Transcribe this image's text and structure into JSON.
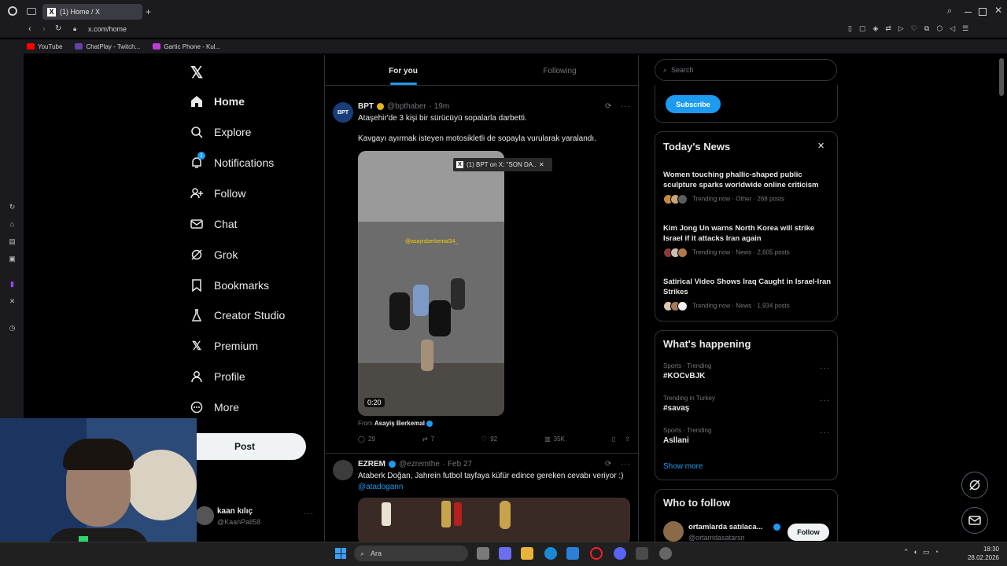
{
  "browser": {
    "tab_title": "(1) Home / X",
    "url": "x.com/home",
    "bookmarks": [
      {
        "label": "YouTube",
        "color": "#ff0000"
      },
      {
        "label": "ChatPlay - Twitch...",
        "color": "#6441a5"
      },
      {
        "label": "Gartic Phone - Kul...",
        "color": "#c03bd8"
      }
    ]
  },
  "nav": {
    "items": [
      {
        "label": "Home",
        "icon": "home-icon"
      },
      {
        "label": "Explore",
        "icon": "search-icon"
      },
      {
        "label": "Notifications",
        "icon": "bell-icon",
        "badge": "1"
      },
      {
        "label": "Follow",
        "icon": "person-plus-icon"
      },
      {
        "label": "Chat",
        "icon": "envelope-icon"
      },
      {
        "label": "Grok",
        "icon": "grok-icon"
      },
      {
        "label": "Bookmarks",
        "icon": "bookmark-icon"
      },
      {
        "label": "Creator Studio",
        "icon": "flask-icon"
      },
      {
        "label": "Premium",
        "icon": "x-logo-icon"
      },
      {
        "label": "Profile",
        "icon": "person-icon"
      },
      {
        "label": "More",
        "icon": "more-circle-icon"
      }
    ],
    "post_label": "Post",
    "account": {
      "name": "kaan kılıç",
      "handle": "@KaanPall58"
    }
  },
  "feed": {
    "tabs": [
      {
        "label": "For you"
      },
      {
        "label": "Following"
      }
    ],
    "tweets": [
      {
        "name": "BPT",
        "handle": "@bpthaber",
        "time": "· 19m",
        "text1": "Ataşehir'de 3 kişi bir sürücüyü sopalarla darbetti.",
        "text2": "Kavgayı ayırmak isteyen motosikletli de sopayla vurularak yaralandı.",
        "video_watermark": "@asayisberkemal34_",
        "video_duration": "0:20",
        "tooltip": "(1) BPT on X: \"SON DA...",
        "from_label": "From",
        "from_name": "Asayiş Berkemal",
        "replies": "29",
        "reposts": "7",
        "likes": "92",
        "views": "35K",
        "avatar_text": "BPT"
      },
      {
        "name": "EZREM",
        "handle": "@ezremthe",
        "time": "· Feb 27",
        "text1": "Ataberk Doğan, Jahrein futbol tayfaya küfür edince gereken cevabı veriyor :)",
        "mention": "@atadogann"
      }
    ]
  },
  "right": {
    "search_placeholder": "Search",
    "subscribe_label": "Subscribe",
    "todays_news": {
      "title": "Today's News",
      "items": [
        {
          "headline": "Women touching phallic-shaped public sculpture sparks worldwide online criticism",
          "meta": "Trending now · Other · 268 posts"
        },
        {
          "headline": "Kim Jong Un warns North Korea will strike Israel if it attacks Iran again",
          "meta": "Trending now · News · 2,605 posts"
        },
        {
          "headline": "Satirical Video Shows Iraq Caught in Israel-Iran Strikes",
          "meta": "Trending now · News · 1,934 posts"
        }
      ]
    },
    "whats_happening": {
      "title": "What's happening",
      "items": [
        {
          "category": "Sports · Trending",
          "name": "#KOCvBJK"
        },
        {
          "category": "Trending in Turkey",
          "name": "#savaş"
        },
        {
          "category": "Sports · Trending",
          "name": "Asllani"
        }
      ],
      "show_more": "Show more"
    },
    "who_to_follow": {
      "title": "Who to follow",
      "user_name": "ortamlarda satılaca...",
      "user_handle": "@ortamdasatarsn",
      "follow_label": "Follow"
    }
  },
  "taskbar": {
    "search_placeholder": "Ara",
    "time": "18:30",
    "date": "28.02.2026"
  },
  "colors": {
    "accent": "#1d9bf0",
    "bg": "#000000",
    "border": "#2f3336",
    "muted": "#71767b"
  }
}
